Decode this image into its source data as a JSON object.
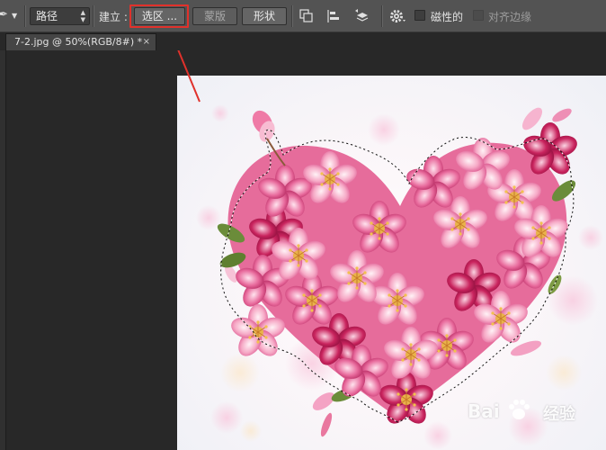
{
  "options_bar": {
    "mode_select": "路径",
    "make_label": "建立 :",
    "selection_button": "选区 ...",
    "mask_button": "蒙版",
    "shape_button": "形状",
    "magnetic_label": "磁性的",
    "align_edges_label": "对齐边缘",
    "highlight_color": "#e0312b"
  },
  "document_tab": {
    "title": "7-2.jpg @ 50%(RGB/8#) *",
    "close_glyph": "×"
  },
  "canvas": {
    "image_subject": "heart of pink cherry blossoms with dashed selection outline"
  },
  "watermark": {
    "left": "Bai",
    "right": "经验"
  },
  "colors": {
    "panel_bg": "#535353",
    "workspace_bg": "#282828",
    "annotation": "#e0312b"
  }
}
